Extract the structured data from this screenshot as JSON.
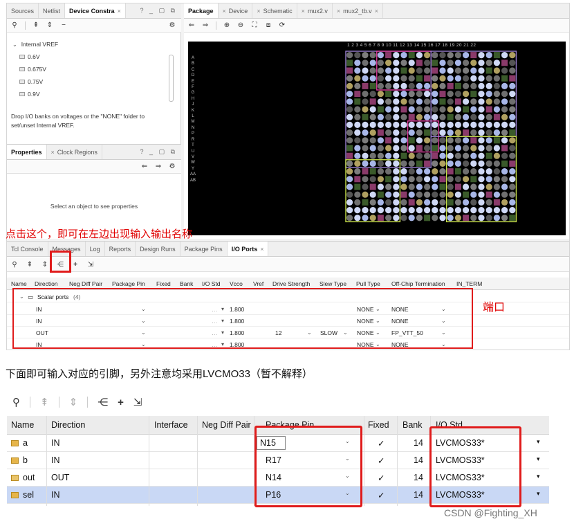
{
  "left_panel": {
    "tabs": [
      "Sources",
      "Netlist",
      "Device Constra"
    ],
    "active_tab": "Device Constra",
    "vref_group": "Internal VREF",
    "vref_items": [
      "0.6V",
      "0.675V",
      "0.75V",
      "0.9V"
    ],
    "hint_line1": "Drop I/O banks on voltages or the \"NONE\" folder to",
    "hint_line2": "set/unset Internal VREF."
  },
  "props_panel": {
    "tabs": [
      "Properties",
      "Clock Regions"
    ],
    "empty_text": "Select an object to see properties"
  },
  "pkg_panel": {
    "tabs": [
      "Package",
      "Device",
      "Schematic",
      "mux2.v",
      "mux2_tb.v"
    ],
    "active_tab": "Package",
    "row_labels": [
      "A",
      "B",
      "C",
      "D",
      "E",
      "F",
      "G",
      "H",
      "J",
      "K",
      "L",
      "M",
      "N",
      "P",
      "R",
      "T",
      "U",
      "V",
      "W",
      "Y",
      "AA",
      "AB"
    ],
    "col_labels": "1 2 3 4 5 6 7 8 9 10 11 12 13 14 15 16 17 18 19 20 21 22"
  },
  "annotation_tool": "点击这个，即可在左边出现输入输出名称",
  "annotation_ports": "端口",
  "console": {
    "tabs": [
      "Tcl Console",
      "Messages",
      "Log",
      "Reports",
      "Design Runs",
      "Package Pins",
      "I/O Ports"
    ],
    "active_tab": "I/O Ports",
    "columns": [
      "Name",
      "Direction",
      "Neg Diff Pair",
      "Package Pin",
      "Fixed",
      "Bank",
      "I/O Std",
      "Vcco",
      "Vref",
      "Drive Strength",
      "Slew Type",
      "Pull Type",
      "Off-Chip Termination",
      "IN_TERM"
    ],
    "group_label": "Scalar ports",
    "group_count": "(4)",
    "rows": [
      {
        "direction": "IN",
        "vcco": "1.800",
        "drive": "",
        "slew": "",
        "pull": "NONE",
        "term": "NONE"
      },
      {
        "direction": "IN",
        "vcco": "1.800",
        "drive": "",
        "slew": "",
        "pull": "NONE",
        "term": "NONE"
      },
      {
        "direction": "OUT",
        "vcco": "1.800",
        "drive": "12",
        "slew": "SLOW",
        "pull": "NONE",
        "term": "FP_VTT_50"
      },
      {
        "direction": "IN",
        "vcco": "1.800",
        "drive": "",
        "slew": "",
        "pull": "NONE",
        "term": "NONE"
      }
    ]
  },
  "explanation": "下面即可输入对应的引脚，另外注意均采用LVCMO33（暂不解释）",
  "io_table": {
    "columns": [
      "Name",
      "Direction",
      "Interface",
      "Neg Diff Pair",
      "Package Pin",
      "Fixed",
      "Bank",
      "I/O Std"
    ],
    "rows": [
      {
        "name": "a",
        "direction": "IN",
        "pin": "N15",
        "fixed": "✓",
        "bank": "14",
        "iostd": "LVCMOS33*"
      },
      {
        "name": "b",
        "direction": "IN",
        "pin": "R17",
        "fixed": "✓",
        "bank": "14",
        "iostd": "LVCMOS33*"
      },
      {
        "name": "out",
        "direction": "OUT",
        "pin": "N14",
        "fixed": "✓",
        "bank": "14",
        "iostd": "LVCMOS33*"
      },
      {
        "name": "sel",
        "direction": "IN",
        "pin": "P16",
        "fixed": "✓",
        "bank": "14",
        "iostd": "LVCMOS33*"
      }
    ]
  },
  "watermark": "CSDN @Fighting_XH",
  "colors": {
    "annotation_red": "#e01b1b",
    "selected_row": "#c9d8f5",
    "package_bg": "#000000"
  }
}
